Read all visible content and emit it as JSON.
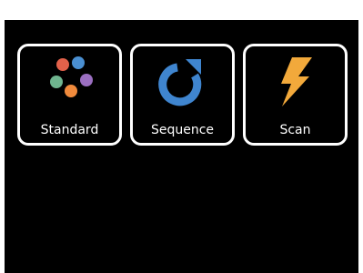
{
  "tiles": [
    {
      "label": "Standard",
      "icon": "palette-dots-icon"
    },
    {
      "label": "Sequence",
      "icon": "refresh-icon"
    },
    {
      "label": "Scan",
      "icon": "lightning-icon"
    }
  ],
  "colors": {
    "background": "#000000",
    "tile_border": "#ffffff",
    "dot_red": "#e2614a",
    "dot_blue": "#4a8fd1",
    "dot_green": "#6fb58f",
    "dot_purple": "#9b6fc1",
    "dot_orange": "#f08a3c",
    "refresh_blue": "#3f85cf",
    "lightning_orange": "#f2a93b"
  }
}
